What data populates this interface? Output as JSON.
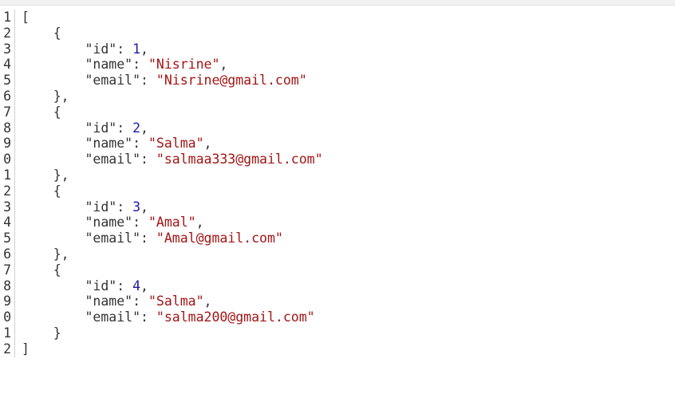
{
  "lines": [
    {
      "num": "1",
      "text": "["
    },
    {
      "num": "2",
      "text": "    {"
    },
    {
      "num": "3",
      "key": "\"id\"",
      "num_value": "1",
      "trail": ","
    },
    {
      "num": "4",
      "key": "\"name\"",
      "str_value": "\"Nisrine\"",
      "trail": ","
    },
    {
      "num": "5",
      "key": "\"email\"",
      "str_value": "\"Nisrine@gmail.com\"",
      "trail": ""
    },
    {
      "num": "6",
      "text": "    },"
    },
    {
      "num": "7",
      "text": "    {"
    },
    {
      "num": "8",
      "key": "\"id\"",
      "num_value": "2",
      "trail": ","
    },
    {
      "num": "9",
      "key": "\"name\"",
      "str_value": "\"Salma\"",
      "trail": ","
    },
    {
      "num": "0",
      "key": "\"email\"",
      "str_value": "\"salmaa333@gmail.com\"",
      "trail": ""
    },
    {
      "num": "1",
      "text": "    },"
    },
    {
      "num": "2",
      "text": "    {"
    },
    {
      "num": "3",
      "key": "\"id\"",
      "num_value": "3",
      "trail": ","
    },
    {
      "num": "4",
      "key": "\"name\"",
      "str_value": "\"Amal\"",
      "trail": ","
    },
    {
      "num": "5",
      "key": "\"email\"",
      "str_value": "\"Amal@gmail.com\"",
      "trail": ""
    },
    {
      "num": "6",
      "text": "    },"
    },
    {
      "num": "7",
      "text": "    {"
    },
    {
      "num": "8",
      "key": "\"id\"",
      "num_value": "4",
      "trail": ","
    },
    {
      "num": "9",
      "key": "\"name\"",
      "str_value": "\"Salma\"",
      "trail": ","
    },
    {
      "num": "0",
      "key": "\"email\"",
      "str_value": "\"salma200@gmail.com\"",
      "trail": ""
    },
    {
      "num": "1",
      "text": "    }"
    },
    {
      "num": "2",
      "text": "]"
    }
  ],
  "colors": {
    "key": "#333333",
    "string": "#a31515",
    "number": "#1a1aa6",
    "gutter": "#333333"
  }
}
